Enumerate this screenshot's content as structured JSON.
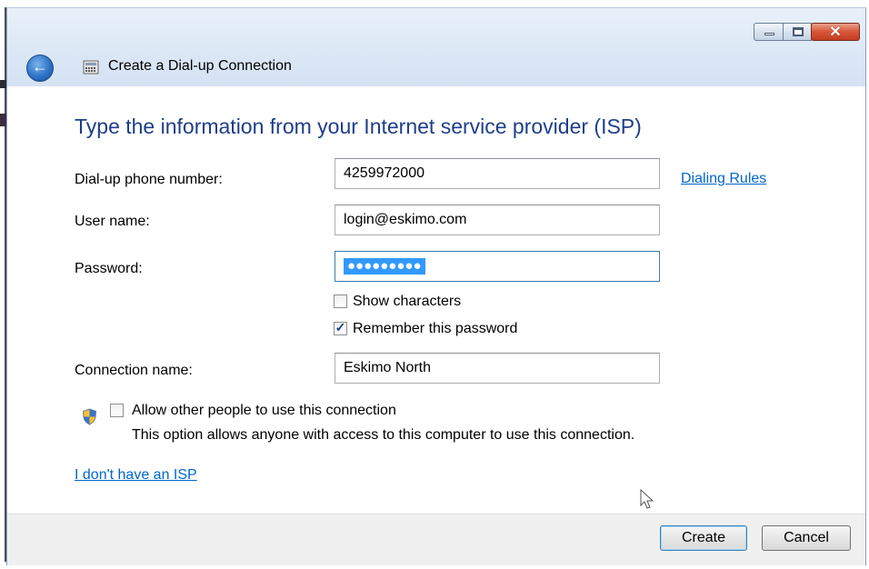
{
  "window": {
    "title": "Create a Dial-up Connection",
    "controls": {
      "minimize_icon": "minimize-icon",
      "maximize_icon": "maximize-icon",
      "close_label": "✕"
    }
  },
  "heading": "Type the information from your Internet service provider (ISP)",
  "form": {
    "phone": {
      "label": "Dial-up phone number:",
      "value": "4259972000"
    },
    "dialing_rules_link": "Dialing Rules",
    "username": {
      "label": "User name:",
      "value": "login@eskimo.com"
    },
    "password": {
      "label": "Password:",
      "value": "●●●●●●●●●"
    },
    "show_characters": {
      "label": "Show characters",
      "checked": false
    },
    "remember_password": {
      "label": "Remember this password",
      "checked": true
    },
    "connection_name": {
      "label": "Connection name:",
      "value": "Eskimo North"
    },
    "allow_others": {
      "label": "Allow other people to use this connection",
      "description": "This option allows anyone with access to this computer to use this connection.",
      "checked": false
    },
    "no_isp_link": "I don't have an ISP"
  },
  "buttons": {
    "create": "Create",
    "cancel": "Cancel"
  },
  "icons": {
    "back": "back-arrow-icon",
    "app": "dialup-modem-icon",
    "shield": "uac-shield-icon",
    "cursor": "mouse-cursor-icon"
  },
  "colors": {
    "heading": "#1e3e8a",
    "link": "#0066cc",
    "selection": "#3399ff",
    "close": "#c33d20"
  }
}
